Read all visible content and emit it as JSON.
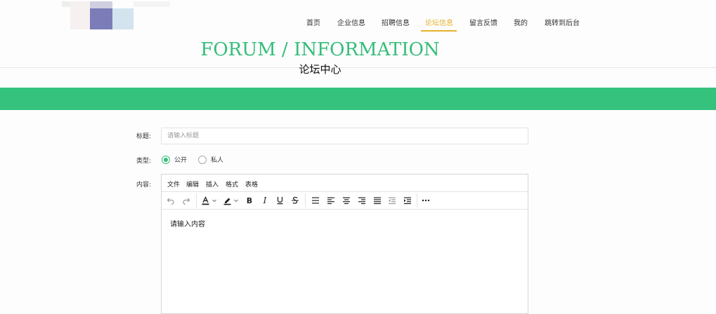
{
  "nav": {
    "items": [
      {
        "label": "首页",
        "name": "nav-home"
      },
      {
        "label": "企业信息",
        "name": "nav-company"
      },
      {
        "label": "招聘信息",
        "name": "nav-recruit"
      },
      {
        "label": "论坛信息",
        "name": "nav-forum",
        "active": true
      },
      {
        "label": "留言反馈",
        "name": "nav-feedback"
      },
      {
        "label": "我的",
        "name": "nav-mine"
      },
      {
        "label": "跳转到后台",
        "name": "nav-admin"
      }
    ]
  },
  "hero": {
    "title": "FORUM / INFORMATION",
    "subtitle": "论坛中心"
  },
  "form": {
    "title_label": "标题:",
    "title_placeholder": "请输入标题",
    "type_label": "类型:",
    "type_options": [
      {
        "label": "公开",
        "checked": true
      },
      {
        "label": "私人",
        "checked": false
      }
    ],
    "content_label": "内容:"
  },
  "editor": {
    "menu": [
      "文件",
      "编辑",
      "插入",
      "格式",
      "表格"
    ],
    "placeholder": "请输入内容"
  },
  "colors": {
    "accent_green": "#34c27d",
    "nav_active": "#e6b12c"
  }
}
